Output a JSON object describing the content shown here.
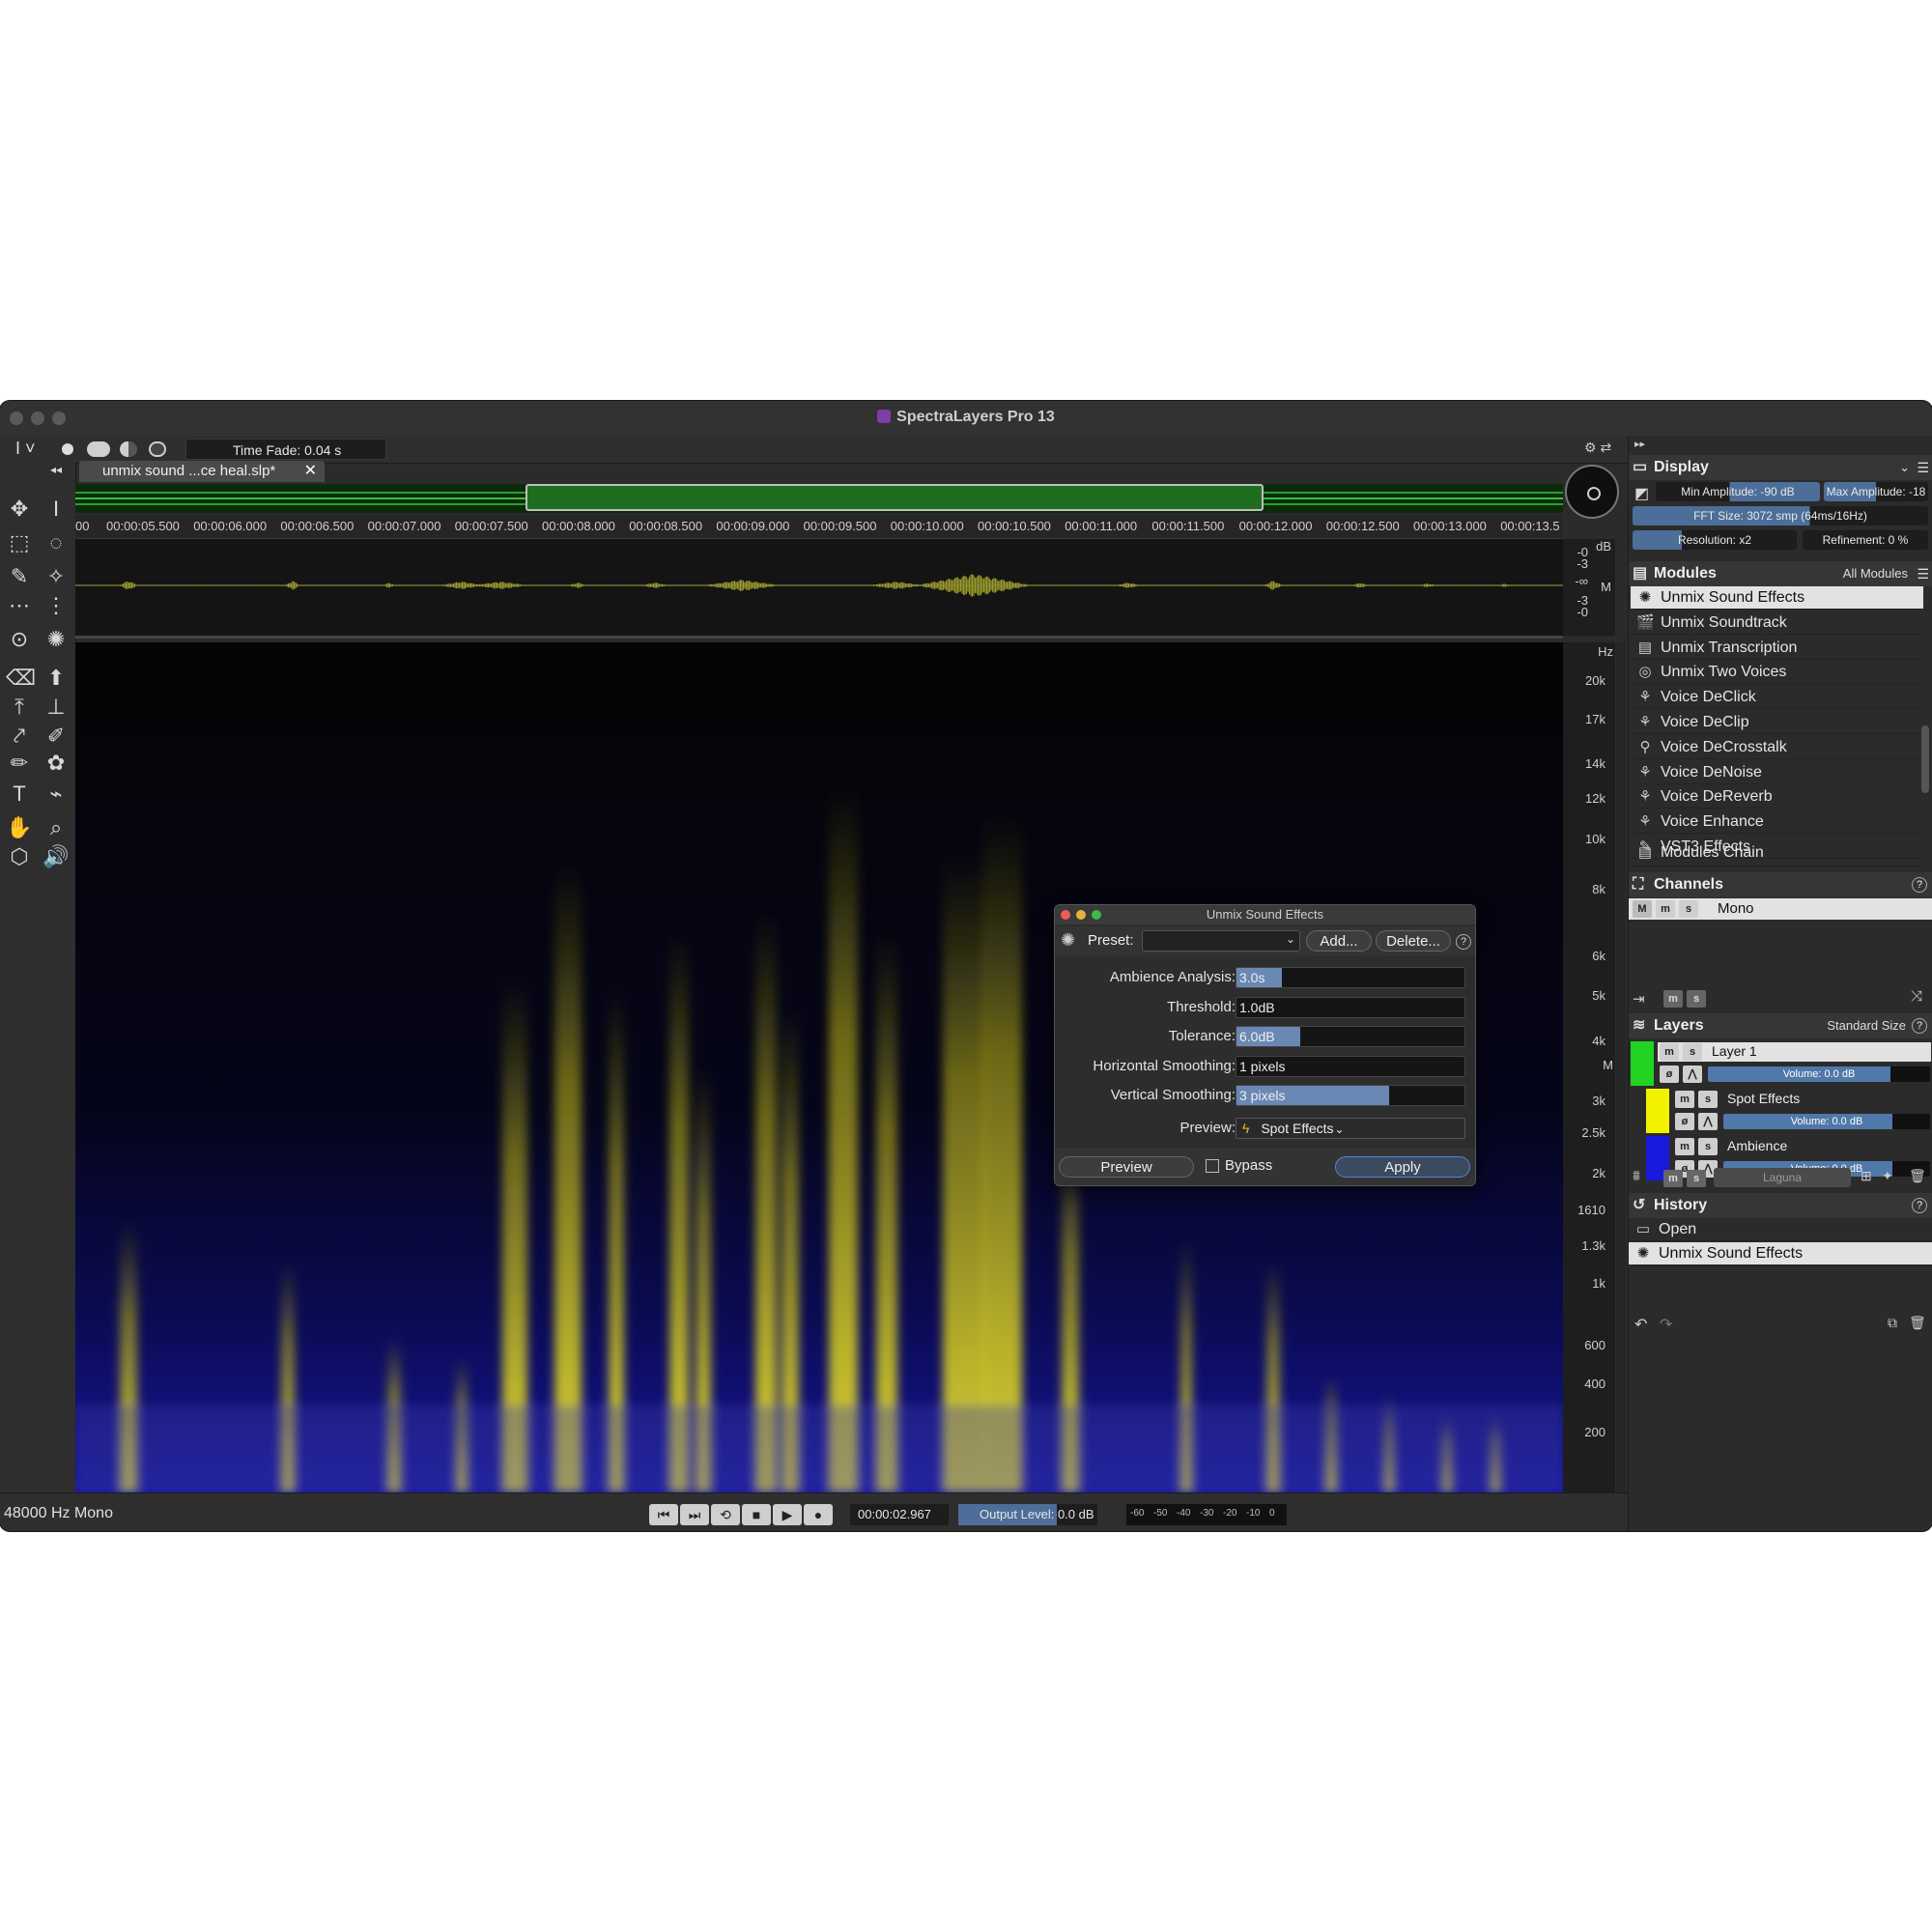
{
  "app": {
    "title": "SpectraLayers Pro 13"
  },
  "toolbar": {
    "time_fade": "Time Fade: 0.04 s"
  },
  "tab": {
    "label": "unmix sound ...ce heal.slp*"
  },
  "ruler": {
    "ticks": [
      "00:00:05.500",
      "00:00:06.000",
      "00:00:06.500",
      "00:00:07.000",
      "00:00:07.500",
      "00:00:08.000",
      "00:00:08.500",
      "00:00:09.000",
      "00:00:09.500",
      "00:00:10.000",
      "00:00:10.500",
      "00:00:11.000",
      "00:00:11.500",
      "00:00:12.000",
      "00:00:12.500",
      "00:00:13.000",
      "00:00:13.5"
    ]
  },
  "wave_scale": {
    "unit": "dB",
    "labels": [
      "-0",
      "-3",
      "-∞",
      "-3",
      "-0"
    ],
    "channel": "M"
  },
  "freq_scale": {
    "unit": "Hz",
    "labels": [
      "20k",
      "17k",
      "14k",
      "12k",
      "10k",
      "8k",
      "6k",
      "5k",
      "4k",
      "3k",
      "2.5k",
      "2k",
      "1610",
      "1.3k",
      "1k",
      "600",
      "400",
      "200"
    ],
    "channel": "M"
  },
  "dialog": {
    "title": "Unmix Sound Effects",
    "preset_label": "Preset:",
    "add": "Add...",
    "delete": "Delete...",
    "params": [
      {
        "label": "Ambience Analysis:",
        "value": "3.0s",
        "fill": 0.2
      },
      {
        "label": "Threshold:",
        "value": "1.0dB",
        "fill": 0.0
      },
      {
        "label": "Tolerance:",
        "value": "6.0dB",
        "fill": 0.28
      },
      {
        "label": "Horizontal Smoothing:",
        "value": "1 pixels",
        "fill": 0.0
      },
      {
        "label": "Vertical Smoothing:",
        "value": "3 pixels",
        "fill": 0.67
      }
    ],
    "preview_label": "Preview:",
    "preview_value": "Spot Effects",
    "preview_btn": "Preview",
    "bypass": "Bypass",
    "apply": "Apply"
  },
  "display": {
    "title": "Display",
    "min_amp": "Min Amplitude: -90 dB",
    "max_amp": "Max Amplitude: -18 dB",
    "fft": "FFT Size: 3072 smp (64ms/16Hz)",
    "resolution": "Resolution: x2",
    "refinement": "Refinement: 0 %"
  },
  "modules": {
    "title": "Modules",
    "filter": "All Modules",
    "items": [
      "Unmix Sound Effects",
      "Unmix Soundtrack",
      "Unmix Transcription",
      "Unmix Two Voices",
      "Voice DeClick",
      "Voice DeClip",
      "Voice DeCrosstalk",
      "Voice DeNoise",
      "Voice DeReverb",
      "Voice Enhance",
      "VST3 Effects"
    ],
    "icons": [
      "sparkle-icon",
      "clapper-icon",
      "transcript-icon",
      "voices-icon",
      "declick-icon",
      "declip-icon",
      "crosstalk-icon",
      "denoise-icon",
      "dereverb-icon",
      "enhance-icon",
      "vst-icon"
    ],
    "chain": "Modules Chain"
  },
  "channels": {
    "title": "Channels",
    "items": [
      "Mono"
    ]
  },
  "layers": {
    "title": "Layers",
    "size": "Standard Size",
    "items": [
      {
        "name": "Layer 1",
        "volume": "Volume: 0.0 dB",
        "color": "#22d422"
      },
      {
        "name": "Spot Effects",
        "volume": "Volume: 0.0 dB",
        "color": "#f2f200"
      },
      {
        "name": "Ambience",
        "volume": "Volume: 0.0 dB",
        "color": "#1a1adc"
      }
    ],
    "blend": "Laguna"
  },
  "history": {
    "title": "History",
    "items": [
      "Open",
      "Unmix Sound Effects"
    ]
  },
  "status": {
    "sample_rate": "48000 Hz Mono",
    "timecode": "00:00:02.967",
    "output_level": "Output Level: 0.0 dB",
    "meter_labels": [
      "-60",
      "-50",
      "-40",
      "-30",
      "-20",
      "-10",
      "0"
    ]
  },
  "colors": {
    "waveform": "#9a9a2a",
    "spectrum_high": "#e8e000",
    "spectrum_low": "#1818a0",
    "accent": "#4c6e99"
  }
}
